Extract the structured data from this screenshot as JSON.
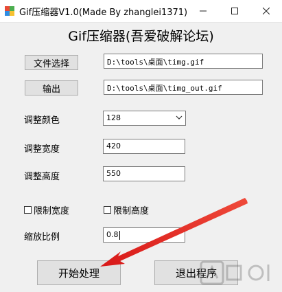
{
  "window": {
    "title": "Gif压缩器V1.0(Made By zhanglei1371)",
    "minimize_icon": "minimize-icon",
    "maximize_icon": "maximize-icon",
    "close_icon": "close-icon"
  },
  "heading": "Gif压缩器(吾爱破解论坛)",
  "file_select": {
    "button_label": "文件选择",
    "path": "D:\\tools\\桌面\\timg.gif"
  },
  "output": {
    "button_label": "输出",
    "path": "D:\\tools\\桌面\\timg_out.gif"
  },
  "colors_setting": {
    "label": "调整颜色",
    "selected": "128"
  },
  "width_setting": {
    "label": "调整宽度",
    "value": "420"
  },
  "height_setting": {
    "label": "调整高度",
    "value": "550"
  },
  "checkboxes": {
    "limit_width": {
      "label": "限制宽度",
      "checked": false
    },
    "limit_height": {
      "label": "限制高度",
      "checked": false
    }
  },
  "scale_setting": {
    "label": "缩放比例",
    "value": "0.8"
  },
  "actions": {
    "start_label": "开始处理",
    "exit_label": "退出程序"
  },
  "colors": {
    "annotation_arrow": "#e02020",
    "button_face": "#e1e1e1"
  }
}
